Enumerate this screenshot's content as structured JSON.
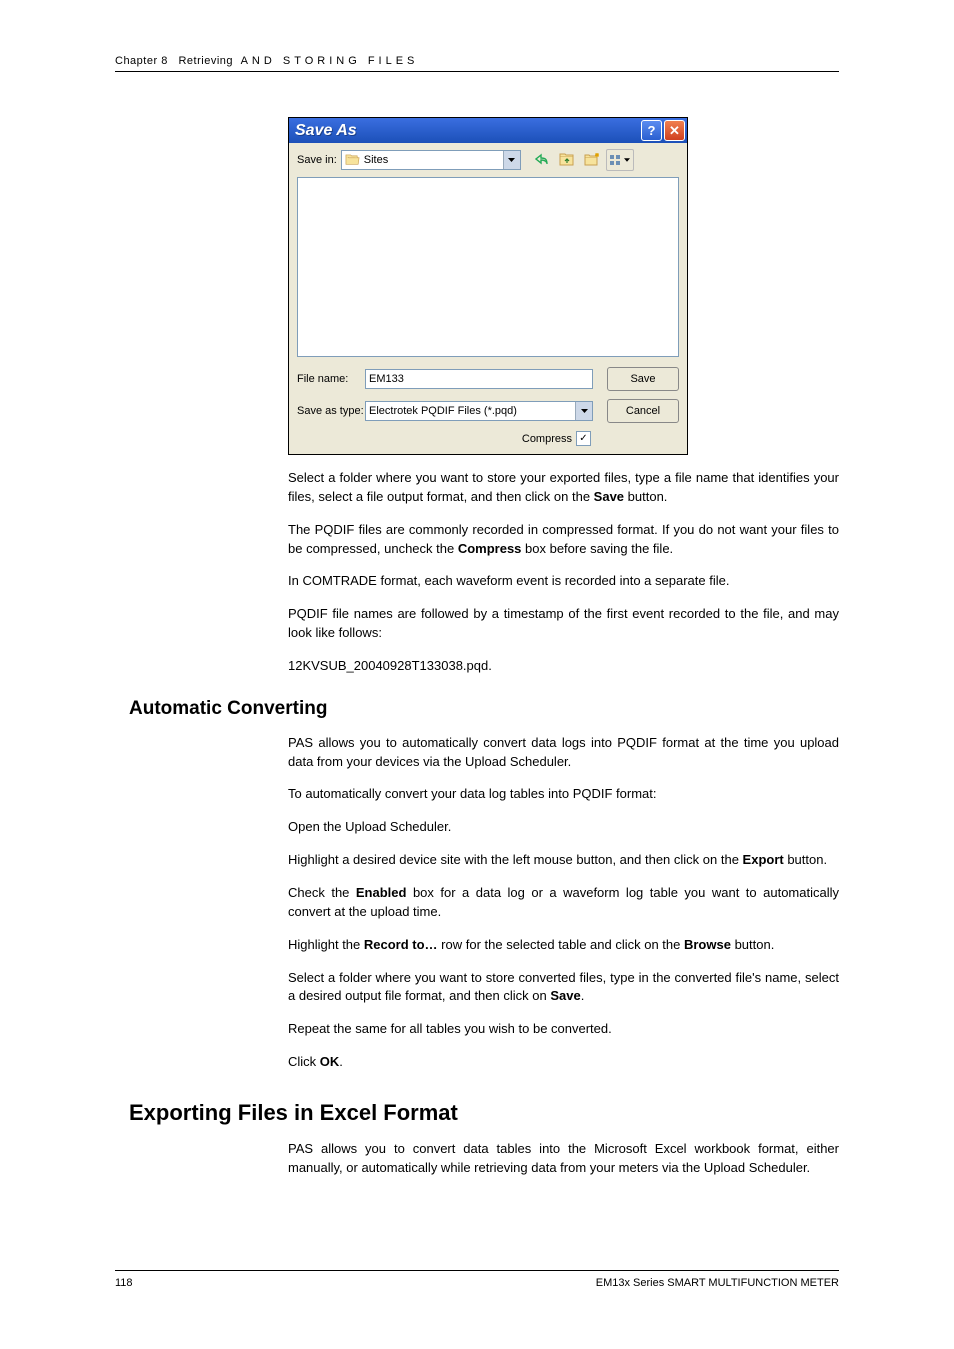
{
  "header": {
    "chapter": "Chapter 8",
    "title_plain": "Retrieving",
    "title_spaced": "AND STORING FILES"
  },
  "dialog": {
    "title": "Save As",
    "savein_label": "Save in:",
    "savein_value": "Sites",
    "filename_label": "File name:",
    "filename_value": "EM133",
    "filetype_label": "Save as type:",
    "filetype_value": "Electrotek PQDIF Files (*.pqd)",
    "save_btn": "Save",
    "cancel_btn": "Cancel",
    "compress_label": "Compress",
    "compress_checked": "✓"
  },
  "paragraphs": {
    "p1a": "Select a folder where you want to store your exported files, type a file name that identifies your files, select a file output format, and then click on the ",
    "p1b": "Save",
    "p1c": " button.",
    "p2a": "The PQDIF files are commonly recorded in compressed format. If you do not want your files to be compressed, uncheck the ",
    "p2b": "Compress",
    "p2c": " box before saving the file.",
    "p3": "In COMTRADE format, each waveform event is recorded into a separate file.",
    "p4": "PQDIF file names are followed by a timestamp of the first event recorded to the file, and may look like follows:",
    "p5": "12KVSUB_20040928T133038.pqd.",
    "h_auto": "Automatic Converting",
    "p6": "PAS allows you to automatically convert data logs into PQDIF format at the time you upload data from your devices via the Upload Scheduler.",
    "p7": "To automatically convert your data log tables into PQDIF format:",
    "p8": "Open the Upload Scheduler.",
    "p9a": "Highlight a desired device site with the left mouse button, and then click on the ",
    "p9b": "Export",
    "p9c": " button.",
    "p10a": "Check the ",
    "p10b": "Enabled",
    "p10c": " box for a data log or a waveform log table you want to automatically convert at the upload time.",
    "p11a": "Highlight the ",
    "p11b": "Record to…",
    "p11c": " row for the selected table and click on the ",
    "p11d": "Browse",
    "p11e": " button.",
    "p12a": "Select a folder where you want to store converted files, type in the converted file's name, select a desired output file format, and then click on ",
    "p12b": "Save",
    "p12c": ".",
    "p13": "Repeat the same for all tables you wish to be converted.",
    "p14a": "Click ",
    "p14b": "OK",
    "p14c": ".",
    "h_excel": "Exporting Files in Excel Format",
    "p15": "PAS allows you to convert data tables into the Microsoft Excel workbook format, either manually, or automatically while retrieving data from your meters via the Upload Scheduler."
  },
  "footer": {
    "page": "118",
    "title": "EM13x Series SMART MULTIFUNCTION METER"
  }
}
